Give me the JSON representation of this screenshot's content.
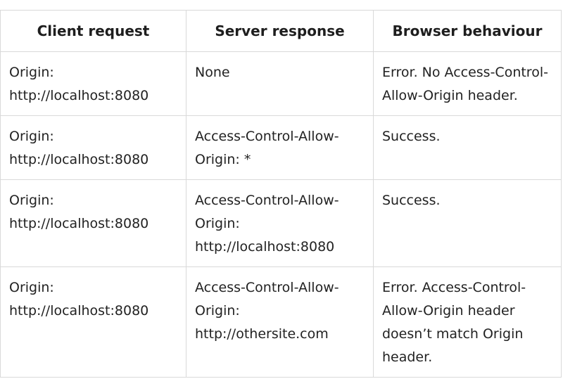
{
  "table": {
    "headers": [
      "Client request",
      "Server response",
      "Browser behaviour"
    ],
    "rows": [
      {
        "client": [
          "Origin:",
          "http://localhost:8080"
        ],
        "server": [
          "None"
        ],
        "browser": [
          "Error. No Access-Control-",
          "Allow-Origin header."
        ]
      },
      {
        "client": [
          "Origin:",
          "http://localhost:8080"
        ],
        "server": [
          "Access-Control-Allow-",
          "Origin: *"
        ],
        "browser": [
          "Success."
        ]
      },
      {
        "client": [
          "Origin:",
          "http://localhost:8080"
        ],
        "server": [
          "Access-Control-Allow-",
          "Origin:",
          "http://localhost:8080"
        ],
        "browser": [
          "Success."
        ]
      },
      {
        "client": [
          "Origin:",
          "http://localhost:8080"
        ],
        "server": [
          "Access-Control-Allow-",
          "Origin:",
          "http://othersite.com"
        ],
        "browser": [
          "Error. Access-Control-",
          "Allow-Origin header",
          "doesn’t match Origin",
          "header."
        ]
      }
    ]
  }
}
